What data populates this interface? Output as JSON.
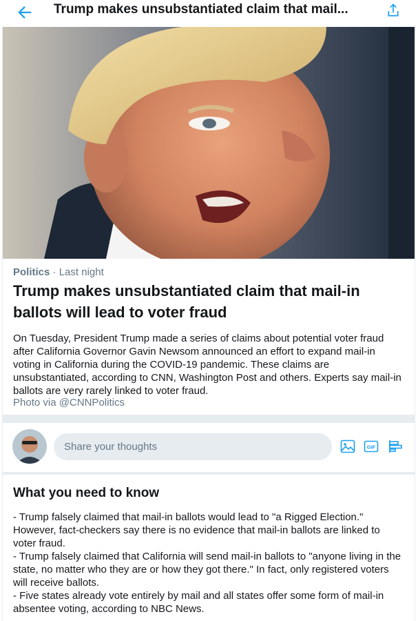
{
  "header": {
    "title": "Trump makes unsubstantiated claim that mail...",
    "accent": "#1da1f2"
  },
  "article": {
    "category": "Politics",
    "time": "Last night",
    "separator": "·",
    "headline": "Trump makes unsubstantiated claim that mail-in ballots will lead to voter fraud",
    "summary": "On Tuesday, President Trump made a series of claims about potential voter fraud after California Governor Gavin Newsom announced an effort to expand mail-in voting in California during the COVID-19 pandemic. These claims are unsubstantiated, according to CNN, Washington Post and others. Experts say mail-in ballots are very rarely linked to voter fraud.",
    "photo_credit": "Photo via @CNNPolitics"
  },
  "composer": {
    "placeholder": "Share your thoughts"
  },
  "know": {
    "heading": "What you need to know",
    "points": [
      "- Trump falsely claimed that mail-in ballots would lead to \"a Rigged Election.\" However, fact-checkers say there is no evidence that mail-in ballots are linked to voter fraud.",
      "- Trump falsely claimed that California will send mail-in ballots to \"anyone living in the state, no matter who they are or how they got there.\" In fact, only registered voters will receive ballots.",
      "- Five states already vote entirely by mail and all states offer some form of mail-in absentee voting, according to NBC News."
    ]
  }
}
